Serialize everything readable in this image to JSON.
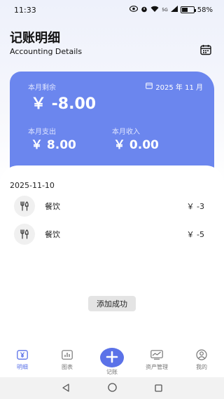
{
  "status_bar": {
    "time": "11:33",
    "network": "5G",
    "battery": "58%",
    "battery_level": 0.58
  },
  "header": {
    "title": "记账明细",
    "subtitle": "Accounting Details"
  },
  "summary": {
    "month": "2025 年 11 月",
    "balance_label": "本月剩余",
    "balance_value": "￥ -8.00",
    "expense_label": "本月支出",
    "expense_value": "￥ 8.00",
    "income_label": "本月收入",
    "income_value": "￥ 0.00"
  },
  "records": {
    "date": "2025-11-10",
    "items": [
      {
        "category": "餐饮",
        "amount": "￥ -3",
        "icon": "utensils-icon"
      },
      {
        "category": "餐饮",
        "amount": "￥ -5",
        "icon": "utensils-icon"
      }
    ]
  },
  "toast": "添加成功",
  "bottom_nav": {
    "items": [
      {
        "label": "明细",
        "icon": "yen-icon",
        "active": true
      },
      {
        "label": "图表",
        "icon": "chart-icon",
        "active": false
      },
      {
        "label": "记账",
        "icon": "plus-icon",
        "active": false
      },
      {
        "label": "资产管理",
        "icon": "asset-icon",
        "active": false
      },
      {
        "label": "我的",
        "icon": "user-icon",
        "active": false
      }
    ]
  },
  "colors": {
    "card": "#6b86ee",
    "accent": "#5b72e8"
  }
}
